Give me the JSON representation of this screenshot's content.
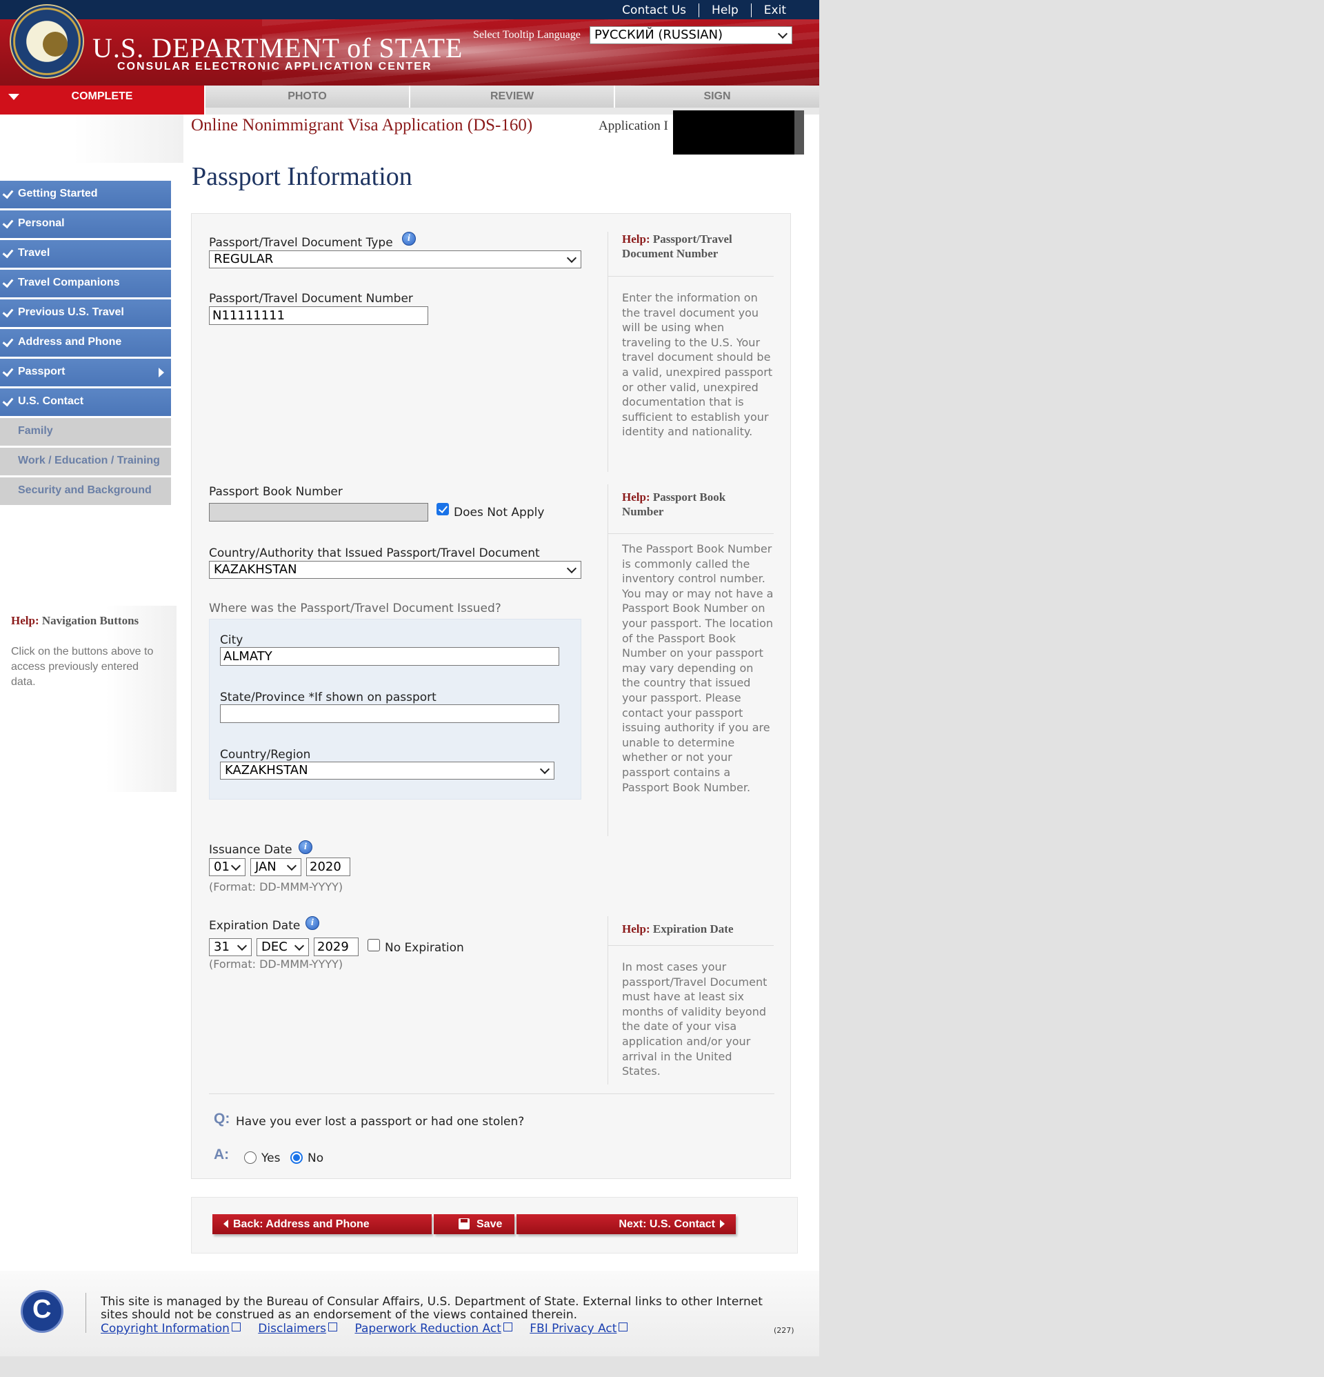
{
  "header": {
    "dept_title": "U.S. DEPARTMENT of STATE",
    "dept_subtitle": "CONSULAR ELECTRONIC APPLICATION CENTER",
    "links": [
      "Contact Us",
      "Help",
      "Exit"
    ],
    "tooltip_language_label": "Select Tooltip Language",
    "tooltip_language_value": "РУССКИЙ (RUSSIAN)"
  },
  "steps": [
    "COMPLETE",
    "PHOTO",
    "REVIEW",
    "SIGN"
  ],
  "app_title": "Online Nonimmigrant Visa Application (DS-160)",
  "app_id_label": "Application I",
  "page_title": "Passport Information",
  "nav": {
    "items": [
      {
        "label": "Getting Started",
        "status": "done"
      },
      {
        "label": "Personal",
        "status": "done"
      },
      {
        "label": "Travel",
        "status": "done"
      },
      {
        "label": "Travel Companions",
        "status": "done"
      },
      {
        "label": "Previous U.S. Travel",
        "status": "done"
      },
      {
        "label": "Address and Phone",
        "status": "done"
      },
      {
        "label": "Passport",
        "status": "current"
      },
      {
        "label": "U.S. Contact",
        "status": "done"
      },
      {
        "label": "Family",
        "status": "todo"
      },
      {
        "label": "Work / Education / Training",
        "status": "todo"
      },
      {
        "label": "Security and Background",
        "status": "todo"
      }
    ],
    "help_prefix": "Help:",
    "help_title": "Navigation Buttons",
    "help_text": "Click on the buttons above to access previously entered data."
  },
  "form": {
    "doc_type_label": "Passport/Travel Document Type",
    "doc_type_value": "REGULAR",
    "doc_number_label": "Passport/Travel Document Number",
    "doc_number_value": "N11111111",
    "book_number_label": "Passport Book Number",
    "book_number_value": "",
    "book_does_not_apply_label": "Does Not Apply",
    "book_does_not_apply_checked": true,
    "issuing_country_label": "Country/Authority that Issued Passport/Travel Document",
    "issuing_country_value": "KAZAKHSTAN",
    "where_issued_label": "Where was the Passport/Travel Document Issued?",
    "city_label": "City",
    "city_value": "ALMATY",
    "state_label": "State/Province *If shown on passport",
    "state_value": "",
    "country_region_label": "Country/Region",
    "country_region_value": "KAZAKHSTAN",
    "issuance_label": "Issuance Date",
    "issuance_day": "01",
    "issuance_month": "JAN",
    "issuance_year": "2020",
    "format_hint": "(Format: DD-MMM-YYYY)",
    "expiration_label": "Expiration Date",
    "expiration_day": "31",
    "expiration_month": "DEC",
    "expiration_year": "2029",
    "no_expiration_label": "No Expiration",
    "no_expiration_checked": false,
    "q_mark": "Q:",
    "a_mark": "A:",
    "question": "Have you ever lost a passport or had one stolen?",
    "answer_yes": "Yes",
    "answer_no": "No",
    "answer_selected": "No"
  },
  "help": {
    "prefix": "Help:",
    "doc_number_title": "Passport/Travel Document Number",
    "doc_number_text": "Enter the information on the travel document you will be using when traveling to the U.S. Your travel document should be a valid, unexpired passport or other valid, unexpired documentation that is sufficient to establish your identity and nationality.",
    "book_number_title": "Passport Book Number",
    "book_number_text": "The Passport Book Number is commonly called the inventory control number. You may or may not have a Passport Book Number on your passport. The location of the Passport Book Number on your passport may vary depending on the country that issued your passport. Please contact your passport issuing authority if you are unable to determine whether or not your passport contains a Passport Book Number.",
    "expiration_title": "Expiration Date",
    "expiration_text": "In most cases your passport/Travel Document must have at least six months of validity beyond the date of your visa application and/or your arrival in the United States."
  },
  "buttons": {
    "back": "Back: Address and Phone",
    "save": "Save",
    "next": "Next: U.S. Contact"
  },
  "footer": {
    "text": "This site is managed by the Bureau of Consular Affairs, U.S. Department of State. External links to other Internet sites should not be construed as an endorsement of the views contained therein.",
    "links": [
      "Copyright Information",
      "Disclaimers",
      "Paperwork Reduction Act",
      "FBI Privacy Act"
    ],
    "code": "(227)"
  },
  "colors": {
    "header_red": "#b4141e",
    "nav_blue": "#4b76b8",
    "button_red": "#b0141e",
    "title_navy": "#1e3461"
  }
}
